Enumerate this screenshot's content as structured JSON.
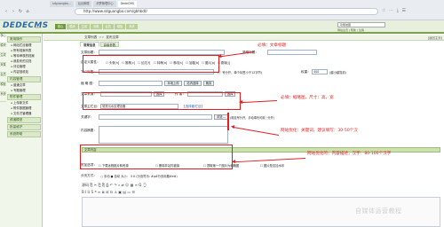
{
  "browser": {
    "tabs": [
      "sdguangbo...",
      "后台管理",
      "织梦管理中心",
      "DedeCMS"
    ],
    "url": "http://www.sdguangbo.com/gbhbdt/",
    "extensions": "☆ ⋯ ⤓ ☰"
  },
  "header": {
    "logo": "DEDECMS",
    "version": "v5.7",
    "tabs": [
      "核心",
      "模块",
      "生成",
      "采集",
      "会员",
      "模板",
      "系统"
    ],
    "active_tab": "核心",
    "search_value": "功能地图",
    "links": "网站主页 | 帮助 | 注销"
  },
  "sidebar": {
    "side_tabs": [
      "核心",
      "模块",
      "生成",
      "采集",
      "会员",
      "模板",
      "系统"
    ],
    "groups": [
      {
        "title": "常用操作",
        "items": [
          "网站栏目管理",
          "所有档案列表",
          "等待审核的档案",
          "我发布的文档",
          "评论管理",
          "内容回收站"
        ]
      },
      {
        "title": "内容管理",
        "items": [
          "普通文章",
          "专题管理"
        ]
      },
      {
        "title": "附件管理",
        "items": [
          "上传新文件",
          "附件数据管理",
          "文件式管理器"
        ]
      },
      {
        "title": "频道模型",
        "items": []
      },
      {
        "title": "批量维护",
        "items": []
      },
      {
        "title": "系统帮助",
        "items": []
      }
    ]
  },
  "main": {
    "breadcrumb": [
      "文章列表",
      "发布文章"
    ],
    "crumb_right": "[返回主页]",
    "subtabs": [
      "常规信息",
      "高级参数"
    ],
    "fields": {
      "title_label": "文章标题：",
      "short_title_label": "简略标题：",
      "attr_label": "自定义属性：",
      "attrs": [
        "头条[h]",
        "推荐[c]",
        "幻灯[f]",
        "特荐[a]",
        "滚动[s]",
        "加粗[b]",
        "图片[p]",
        "跳转[j]"
      ],
      "tag_label": "TAG标签：",
      "tag_hint": "(',' 号分开，单个标签小于12字节)",
      "weight_label": "权重：",
      "weight_value": "400",
      "weight_hint": "(越小越靠前)",
      "thumb_label": "缩 略 图：",
      "thumb_btns": [
        "本地上传",
        "站内选择",
        "裁剪"
      ],
      "source_label": "文章来源：",
      "author_label": "作 者：",
      "select_btn": "选择",
      "column_label": "文章主栏目：",
      "column_value": "常规污水处理设备",
      "column_link": "【选择副栏目】",
      "keywords_label": "关键字：",
      "keywords_hint": "(用逗号分开，手动填写可用','分开)",
      "auto_btn": "浏览...",
      "desc_label": "内容摘要：",
      "edit_bar": "文章内容",
      "opts_label": "附加选项：",
      "opts": [
        "下载远程图片和资源",
        "删除非站内链接",
        "提取第一个图片为缩略图",
        "图片是否加水印"
      ],
      "page_label": "分页方式：",
      "page_opts": "○ 手动 ● 自动 大小： 5  K (分页符为: #p#分页标题#e#)"
    },
    "toolbar_row1": "源码 ⎘ ✂ ⎗ ⎘ ⎙ ↶ ↷ ⌕ ⇄ ☺ ▦ ≡ Ω ⌚",
    "toolbar_row2": "B I U S ❝ ≡ ≣ ⊞ ⊟ ⚓ ▣ ▤ ▭ ☰"
  },
  "annotations": {
    "title_note": "必填：文章标题",
    "thumb_note": "必填：缩略图，尺寸：高，宽",
    "keywords_note": "网站优化：关键词，建议填写：30-50个汉",
    "desc_note": "网站优化的：内容描述，汉字：80-100个汉字"
  },
  "watermark": "自媒体运营教程",
  "colors": {
    "annotation": "#e02020",
    "dede_green": "#7aa04c",
    "logo_blue": "#2f6aa8"
  }
}
